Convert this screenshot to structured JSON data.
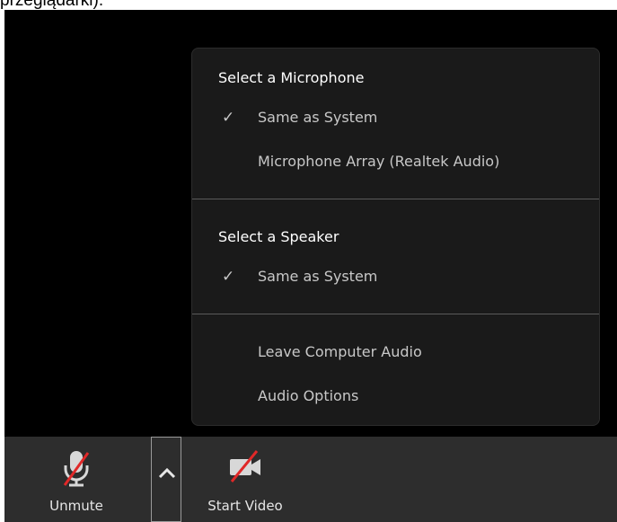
{
  "top_caption": "przeglądarki).",
  "audio_menu": {
    "microphone": {
      "heading": "Select a Microphone",
      "items": [
        {
          "label": "Same as System",
          "checked": true
        },
        {
          "label": "Microphone Array (Realtek Audio)",
          "checked": false
        }
      ]
    },
    "speaker": {
      "heading": "Select a Speaker",
      "items": [
        {
          "label": "Same as System",
          "checked": true
        }
      ]
    },
    "actions": [
      {
        "label": "Leave Computer Audio"
      },
      {
        "label": "Audio Options"
      }
    ],
    "check_glyph": "✓"
  },
  "toolbar": {
    "unmute_label": "Unmute",
    "start_video_label": "Start Video",
    "mic_icon": "microphone-muted-icon",
    "video_icon": "video-off-icon",
    "caret_icon": "chevron-up-icon",
    "mute_slash_color": "#e02828"
  }
}
